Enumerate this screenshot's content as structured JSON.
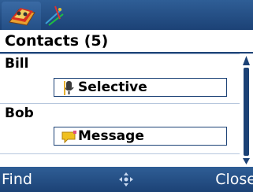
{
  "tabs": [
    {
      "icon": "contacts-book-icon",
      "active": true
    },
    {
      "icon": "presence-signal-icon",
      "active": false
    }
  ],
  "header": {
    "title": "Contacts (5)"
  },
  "contacts": [
    {
      "name": "Bill",
      "status_icon": "microphone-icon",
      "status": "Selective"
    },
    {
      "name": "Bob",
      "status_icon": "message-icon",
      "status": "Message"
    }
  ],
  "softkeys": {
    "left": "Find",
    "center_icon": "navigation-pad-icon",
    "right": "Close"
  },
  "colors": {
    "bar": "#1c4276",
    "separator": "#b7c7dd"
  }
}
